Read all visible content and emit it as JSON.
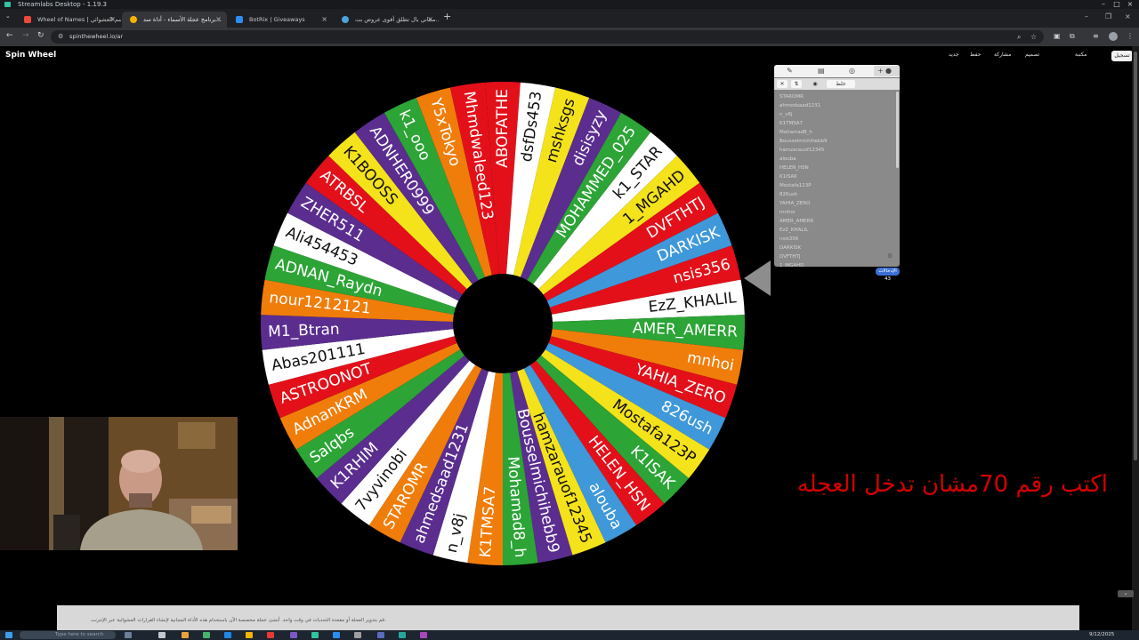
{
  "app": {
    "title": "Streamlabs Desktop - 1.19.3"
  },
  "tabs": [
    {
      "label": "Wheel of Names | إسم العشوائي",
      "favicon_color": "#e84a3c",
      "active": false
    },
    {
      "label": "برنامج عجلة الأسماء - أداة سد...",
      "favicon_color": "#f4b400",
      "active": true
    },
    {
      "label": "BotRix | Giveaways",
      "favicon_color": "#2d8cf0",
      "active": false
    },
    {
      "label": "مجاني بال تطلق أقوى عروض بت...",
      "favicon_color": "#4aa3df",
      "active": false
    }
  ],
  "address": {
    "url": "spinthewheel.io/ar"
  },
  "site": {
    "brand": "Spin Wheel",
    "nav": [
      "جديد",
      "حفظ",
      "مشاركة",
      "تصميم",
      "مكتبة"
    ],
    "login": "تسجيل"
  },
  "wheel": {
    "colors": [
      "#e3101a",
      "#ffffff",
      "#f4e21b",
      "#5a2d8f",
      "#2ca436",
      "#ffffff",
      "#f4e21b",
      "#e3101a",
      "#3f98d9",
      "#e3101a",
      "#ffffff",
      "#2ca436",
      "#f07d0a",
      "#e3101a",
      "#3f98d9",
      "#f4e21b",
      "#2ca436",
      "#e3101a",
      "#3f98d9",
      "#f4e21b",
      "#5a2d8f",
      "#2ca436",
      "#f07d0a",
      "#ffffff",
      "#5a2d8f",
      "#f07d0a",
      "#ffffff",
      "#5a2d8f",
      "#2ca436",
      "#f07d0a",
      "#e3101a",
      "#ffffff",
      "#5a2d8f",
      "#f07d0a",
      "#2ca436",
      "#ffffff",
      "#5a2d8f",
      "#e3101a",
      "#f4e21b",
      "#5a2d8f",
      "#2ca436",
      "#f07d0a"
    ],
    "names": [
      "ABOFATHE",
      "dsfDs453",
      "mshksgs",
      "disisyzy",
      "MOHAMMED_025",
      "k1_STAR",
      "1_MGAHD",
      "DVFTHTJ",
      "DARKISK",
      "nsis356",
      "EzZ_KHALIL",
      "AMER_AMERR",
      "mnhoi",
      "YAHIA_ZERO",
      "826ush",
      "Mostafa123P",
      "K1ISAK",
      "HELEN_HSN",
      "alouba",
      "hamzarauof12345",
      "Bousselmichihebb9",
      "Mohamad8_h",
      "K1TMSA7",
      "n_v8j",
      "ahmedsaad1231",
      "STAROMR",
      "7vyvinobi",
      "K1RHIM",
      "Salqbs",
      "AdnanKRM",
      "ASTROONOT",
      "Abas201111",
      "M1_Btran",
      "nour1212121",
      "ADNAN_Raydn",
      "Ali454453",
      "ZHER511",
      "ATRBSL",
      "K1BOOSS",
      "ADNHER0999",
      "k1_ooo",
      "Y5xTokyo",
      "Mhmdwaleed123"
    ]
  },
  "panel": {
    "shuffle_label": "خلط",
    "count": "الإدخالات 43",
    "entries": [
      "STAROMR",
      "ahmedsaad1231",
      "n_v8j",
      "K1TMSA7",
      "Mohamad8_h",
      "Bousselmichihebb9",
      "hamzarauof12345",
      "alouba",
      "HELEN_HSN",
      "K1ISAK",
      "Mostafa123P",
      "826ush",
      "YAHIA_ZERO",
      "mnhoi",
      "AMER_AMERR",
      "EzZ_KHALIL",
      "nsis356",
      "DARKISK",
      "DVFTHTJ",
      "1_MGAHD"
    ]
  },
  "promo_text": "اكتب رقم 70مشان تدخل العجله",
  "banner_text": "قم بتدوير العجلة أو مقعدة التحديات في وقت واحد. أنشئ عجلة مخصصة الآن باستخدام هذه الأداة المجانية لإنشاء القرارات العشوائية عبر الإنترنت.",
  "taskbar": {
    "search_placeholder": "Type here to search",
    "date": "9/12/2025"
  }
}
